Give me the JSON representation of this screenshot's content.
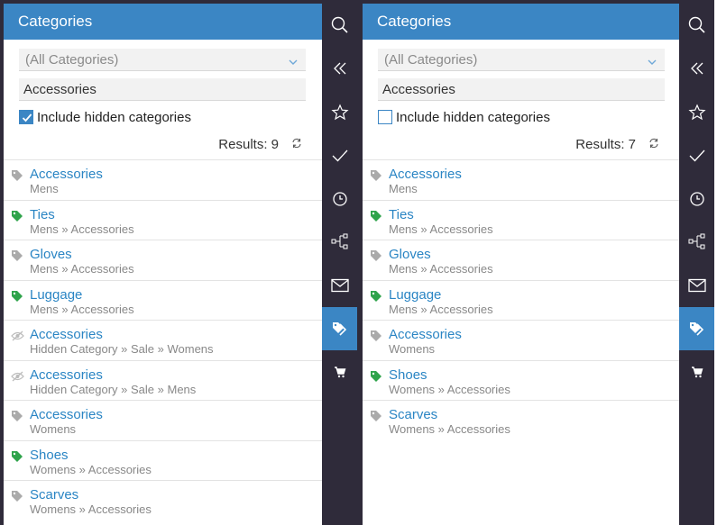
{
  "colors": {
    "accent": "#3b86c4",
    "rail": "#2f2b3a",
    "link": "#2a85c4",
    "tag_gray": "#aaaaaa",
    "tag_green": "#2fa34b"
  },
  "left": {
    "header": {
      "title": "Categories"
    },
    "filter": {
      "selected": "(All Categories)"
    },
    "search": {
      "value": "Accessories"
    },
    "include_hidden": {
      "label": "Include hidden categories",
      "checked": true
    },
    "results": {
      "label": "Results: 9"
    },
    "items": [
      {
        "name": "Accessories",
        "path": "Mens",
        "icon": "tag-gray"
      },
      {
        "name": "Ties",
        "path": "Mens » Accessories",
        "icon": "tag-green"
      },
      {
        "name": "Gloves",
        "path": "Mens » Accessories",
        "icon": "tag-gray"
      },
      {
        "name": "Luggage",
        "path": "Mens » Accessories",
        "icon": "tag-green"
      },
      {
        "name": "Accessories",
        "path": "Hidden Category » Sale » Womens",
        "icon": "eye-hidden"
      },
      {
        "name": "Accessories",
        "path": "Hidden Category » Sale » Mens",
        "icon": "eye-hidden"
      },
      {
        "name": "Accessories",
        "path": "Womens",
        "icon": "tag-gray"
      },
      {
        "name": "Shoes",
        "path": "Womens » Accessories",
        "icon": "tag-green"
      },
      {
        "name": "Scarves",
        "path": "Womens » Accessories",
        "icon": "tag-gray"
      }
    ]
  },
  "right": {
    "header": {
      "title": "Categories"
    },
    "filter": {
      "selected": "(All Categories)"
    },
    "search": {
      "value": "Accessories"
    },
    "include_hidden": {
      "label": "Include hidden categories",
      "checked": false
    },
    "results": {
      "label": "Results: 7"
    },
    "items": [
      {
        "name": "Accessories",
        "path": "Mens",
        "icon": "tag-gray"
      },
      {
        "name": "Ties",
        "path": "Mens » Accessories",
        "icon": "tag-green"
      },
      {
        "name": "Gloves",
        "path": "Mens » Accessories",
        "icon": "tag-gray"
      },
      {
        "name": "Luggage",
        "path": "Mens » Accessories",
        "icon": "tag-green"
      },
      {
        "name": "Accessories",
        "path": "Womens",
        "icon": "tag-gray"
      },
      {
        "name": "Shoes",
        "path": "Womens » Accessories",
        "icon": "tag-green"
      },
      {
        "name": "Scarves",
        "path": "Womens » Accessories",
        "icon": "tag-gray"
      }
    ]
  },
  "rail_icons": [
    "search-icon",
    "collapse-icon",
    "star-icon",
    "check-icon",
    "clock-icon",
    "hierarchy-icon",
    "mail-icon",
    "category-tag-icon",
    "cart-icon"
  ],
  "rail_active": "category-tag-icon"
}
